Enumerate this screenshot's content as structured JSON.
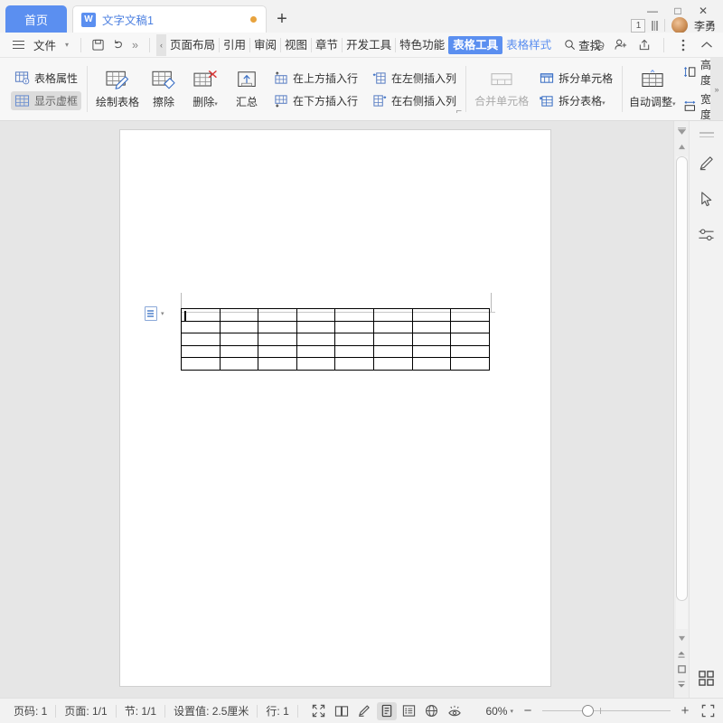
{
  "window": {
    "minimize": "—",
    "maximize": "□",
    "close": "✕",
    "badge_count": "1",
    "user_name": "李勇"
  },
  "tabs": {
    "home_label": "首页",
    "document_label": "文字文稿1",
    "new_tab_label": "+"
  },
  "menu": {
    "file_label": "文件",
    "save_icon": "save-icon",
    "undo_icon": "undo-icon",
    "more_chevron": "»",
    "scroll_left": "‹",
    "items": [
      {
        "label": "页面布局"
      },
      {
        "label": "引用"
      },
      {
        "label": "审阅"
      },
      {
        "label": "视图"
      },
      {
        "label": "章节"
      },
      {
        "label": "开发工具"
      },
      {
        "label": "特色功能"
      }
    ],
    "active_tab": "表格工具",
    "style_tab": "表格样式",
    "find_label": "查找",
    "right_icons": [
      "cloud-sync-icon",
      "add-user-icon",
      "share-icon",
      "more-options-icon",
      "collapse-ribbon-icon"
    ]
  },
  "ribbon": {
    "table_properties": "表格属性",
    "show_gridlines": "显示虚框",
    "draw_table": "绘制表格",
    "erase": "擦除",
    "delete": "删除",
    "summary": "汇总",
    "insert_row_above": "在上方插入行",
    "insert_row_below": "在下方插入行",
    "insert_col_left": "在左侧插入列",
    "insert_col_right": "在右侧插入列",
    "merge_cells": "合并单元格",
    "split_cells": "拆分单元格",
    "split_table": "拆分表格",
    "autofit": "自动调整",
    "height_label": "高度:",
    "width_label": "宽度:",
    "height_value": "",
    "width_value": "",
    "overflow_arrow": "»"
  },
  "document": {
    "table": {
      "columns": 8,
      "rows": 5,
      "cells": [
        [
          "",
          "",
          "",
          "",
          "",
          "",
          "",
          ""
        ],
        [
          "",
          "",
          "",
          "",
          "",
          "",
          "",
          ""
        ],
        [
          "",
          "",
          "",
          "",
          "",
          "",
          "",
          ""
        ],
        [
          "",
          "",
          "",
          "",
          "",
          "",
          "",
          ""
        ],
        [
          "",
          "",
          "",
          "",
          "",
          "",
          "",
          ""
        ]
      ]
    },
    "paste_options_icon": "paste-options-icon"
  },
  "status": {
    "page_number": "页码: 1",
    "page_count": "页面: 1/1",
    "section": "节: 1/1",
    "setting_value": "设置值: 2.5厘米",
    "row": "行: 1",
    "view_icons": [
      "fullscreen-icon",
      "two-page-icon",
      "edit-pen-icon",
      "page-view-icon",
      "outline-view-icon",
      "web-view-icon",
      "eye-protect-icon"
    ],
    "zoom_level": "60%",
    "zoom_out": "−",
    "zoom_in": "+",
    "fit_page_icon": "fit-page-icon"
  },
  "rail": {
    "icons": [
      "menu-lines-icon",
      "pen-icon",
      "cursor-select-icon",
      "settings-sliders-icon",
      "apps-grid-icon"
    ]
  },
  "scrollbar": {
    "up_arrow": "▲",
    "down_arrow": "▼",
    "prev_page_icon": "previous-page-icon",
    "select_object_icon": "select-browse-object-icon",
    "next_page_icon": "next-page-icon"
  },
  "colors": {
    "accent": "#5b8ff0",
    "tab_dot": "#e8a33d",
    "chrome_bg": "#f2f2f2",
    "page_bg": "#ffffff"
  }
}
